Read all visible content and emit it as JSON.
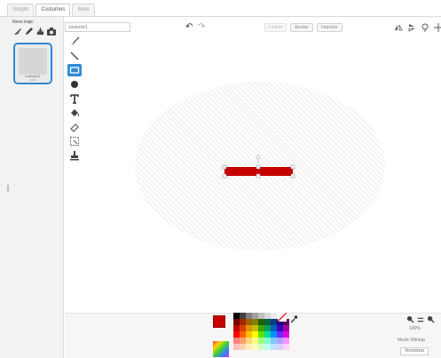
{
  "tabs": [
    {
      "label": "Scripts"
    },
    {
      "label": "Costumes"
    },
    {
      "label": "Sons"
    }
  ],
  "left_panel": {
    "new_costume_label": "Novo traje:",
    "costume": {
      "name": "costume1",
      "size": "1x1"
    }
  },
  "editor": {
    "costume_name_placeholder": "costume1",
    "clear_label": "Limpar",
    "add_label": "Ajustar",
    "import_label": "Importar"
  },
  "zoom": {
    "level": "100%"
  },
  "mode": {
    "label": "Modo: Bitmap",
    "convert_button": "Vectorizar"
  },
  "colors": {
    "current": "#c40000",
    "accent": "#2e8bd6",
    "palette": [
      "#000000",
      "#404040",
      "#808080",
      "#a0a0a0",
      "#c0c0c0",
      "#d8d8d8",
      "#ececec",
      "#ffffff",
      "#f0f0f0",
      "#7a0000",
      "#a02800",
      "#a06000",
      "#808000",
      "#206000",
      "#006040",
      "#004080",
      "#200080",
      "#600060",
      "#c00000",
      "#d84000",
      "#e09000",
      "#c0c000",
      "#40a000",
      "#00a060",
      "#0060c0",
      "#4000c0",
      "#a000a0",
      "#ff0000",
      "#ff6000",
      "#ffc000",
      "#ffff00",
      "#60e000",
      "#00e0a0",
      "#0090ff",
      "#6030ff",
      "#e000e0",
      "#ff8080",
      "#ffa070",
      "#ffd880",
      "#ffff80",
      "#a0ff80",
      "#80ffd0",
      "#80c8ff",
      "#b0a0ff",
      "#ff90ff",
      "#ffc0c0",
      "#ffd0b0",
      "#ffecc0",
      "#ffffc0",
      "#d0ffc0",
      "#c0fff0",
      "#c0e4ff",
      "#d8d0ff",
      "#ffd0ff"
    ]
  },
  "icons": {
    "new_costume": [
      "paint-brush-icon",
      "pencil-icon",
      "import-icon",
      "camera-icon"
    ],
    "tools": [
      "brush-icon",
      "line-icon",
      "rectangle-icon",
      "ellipse-icon",
      "text-icon",
      "fill-icon",
      "eraser-icon",
      "select-icon",
      "stamp-icon"
    ],
    "right": [
      "flip-horizontal-icon",
      "flip-vertical-icon",
      "set-center-icon",
      "center-crosshair-icon"
    ]
  }
}
